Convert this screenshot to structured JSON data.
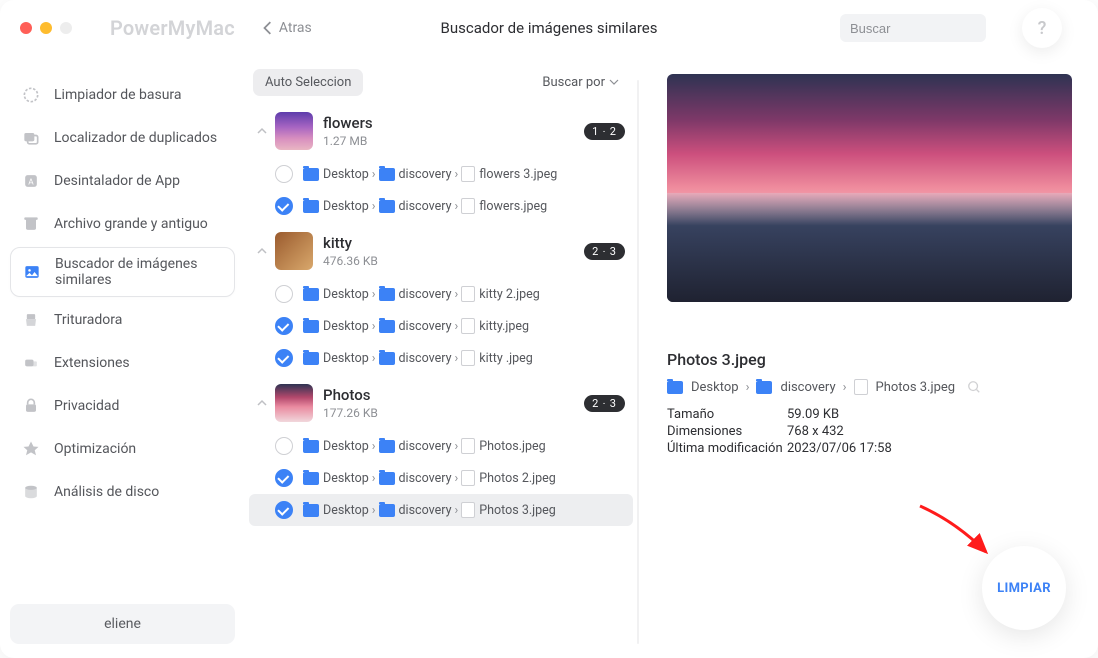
{
  "header": {
    "app_name": "PowerMyMac",
    "back_label": "Atras",
    "title": "Buscador de imágenes similares",
    "search_placeholder": "Buscar",
    "help_label": "?"
  },
  "sidebar": [
    {
      "label": "Limpiador de basura",
      "active": false
    },
    {
      "label": "Localizador de duplicados",
      "active": false
    },
    {
      "label": "Desintalador de App",
      "active": false
    },
    {
      "label": "Archivo grande y antiguo",
      "active": false
    },
    {
      "label": "Buscador de imágenes similares",
      "active": true
    },
    {
      "label": "Trituradora",
      "active": false
    },
    {
      "label": "Extensiones",
      "active": false
    },
    {
      "label": "Privacidad",
      "active": false
    },
    {
      "label": "Optimización",
      "active": false
    },
    {
      "label": "Análisis de disco",
      "active": false
    }
  ],
  "user": "eliene",
  "toolbar": {
    "auto_select": "Auto Seleccion",
    "search_by": "Buscar por"
  },
  "groups": [
    {
      "name": "flowers",
      "size": "1.27 MB",
      "badge": "1 ‧ 2",
      "thumb": "flowers",
      "files": [
        {
          "checked": false,
          "d1": "Desktop",
          "d2": "discovery",
          "fname": "flowers 3.jpeg",
          "selected": false
        },
        {
          "checked": true,
          "d1": "Desktop",
          "d2": "discovery",
          "fname": "flowers.jpeg",
          "selected": false
        }
      ]
    },
    {
      "name": "kitty",
      "size": "476.36 KB",
      "badge": "2 ‧ 3",
      "thumb": "kitty",
      "files": [
        {
          "checked": false,
          "d1": "Desktop",
          "d2": "discovery",
          "fname": "kitty 2.jpeg",
          "selected": false
        },
        {
          "checked": true,
          "d1": "Desktop",
          "d2": "discovery",
          "fname": "kitty.jpeg",
          "selected": false
        },
        {
          "checked": true,
          "d1": "Desktop",
          "d2": "discovery",
          "fname": "kitty .jpeg",
          "selected": false
        }
      ]
    },
    {
      "name": "Photos",
      "size": "177.26 KB",
      "badge": "2 ‧ 3",
      "thumb": "photos",
      "files": [
        {
          "checked": false,
          "d1": "Desktop",
          "d2": "discovery",
          "fname": "Photos.jpeg",
          "selected": false
        },
        {
          "checked": true,
          "d1": "Desktop",
          "d2": "discovery",
          "fname": "Photos 2.jpeg",
          "selected": false
        },
        {
          "checked": true,
          "d1": "Desktop",
          "d2": "discovery",
          "fname": "Photos 3.jpeg",
          "selected": true
        }
      ]
    }
  ],
  "preview": {
    "name": "Photos 3.jpeg",
    "path_d1": "Desktop",
    "path_d2": "discovery",
    "path_fname": "Photos 3.jpeg",
    "meta": {
      "size_k": "Tamaño",
      "size_v": "59.09 KB",
      "dim_k": "Dimensiones",
      "dim_v": "768 x 432",
      "mod_k": "Última modificación",
      "mod_v": "2023/07/06 17:58"
    }
  },
  "clean_btn": "LIMPIAR"
}
